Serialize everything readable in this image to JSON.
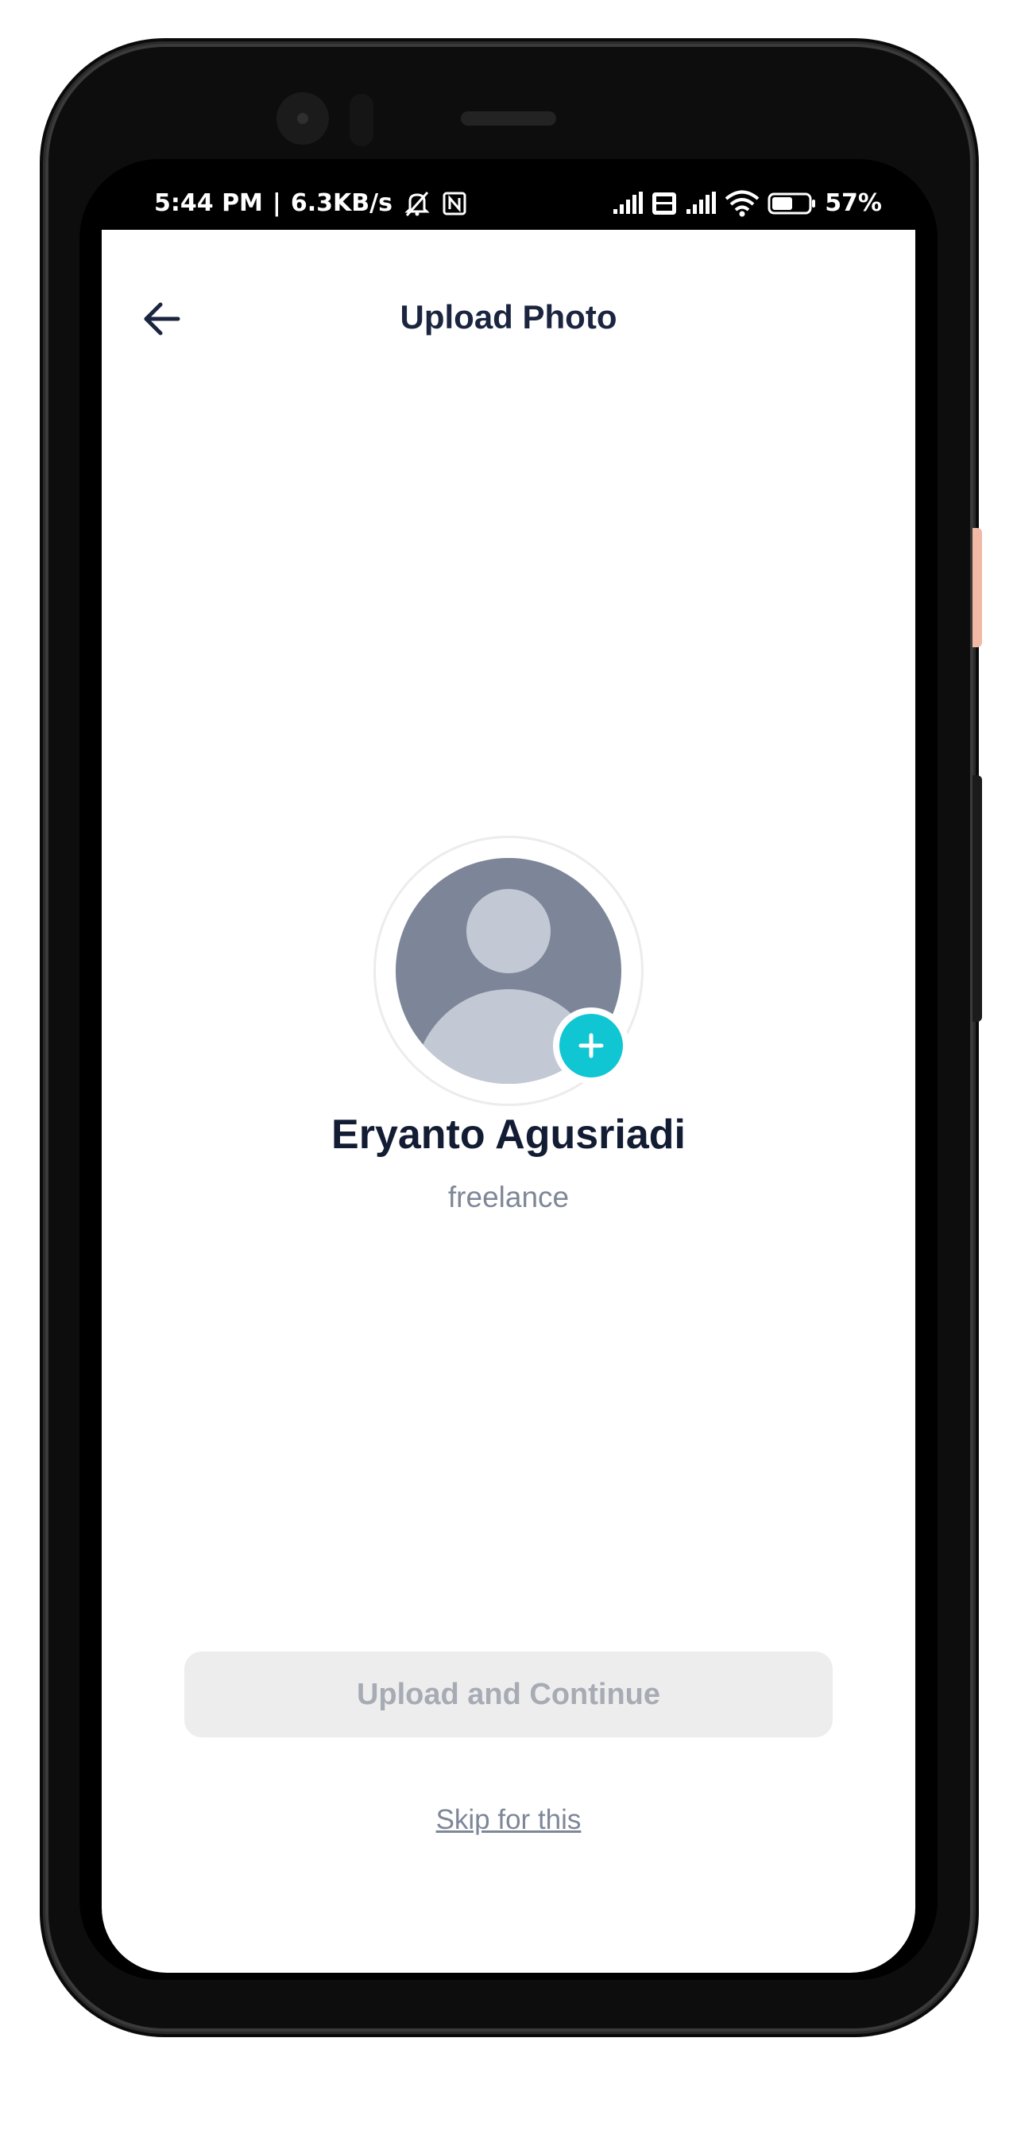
{
  "status_bar": {
    "time": "5:44 PM",
    "separator": "|",
    "network_speed": "6.3KB/s",
    "battery_percent": "57%",
    "battery_level": 0.57,
    "icons": [
      "mute-icon",
      "nfc-icon",
      "signal-icon",
      "volte-icon",
      "signal-icon",
      "wifi-icon",
      "battery-icon"
    ]
  },
  "header": {
    "title": "Upload Photo",
    "back_icon": "arrow-left-icon"
  },
  "profile": {
    "name": "Eryanto Agusriadi",
    "role": "freelance",
    "avatar_icon": "user-placeholder-icon",
    "add_icon": "plus-icon"
  },
  "actions": {
    "primary_label": "Upload and Continue",
    "primary_enabled": false,
    "skip_label": "Skip for this"
  },
  "colors": {
    "accent": "#10c6d2",
    "title_text": "#1b2540",
    "muted_text": "#7e8798",
    "disabled_button_bg": "#ededee",
    "disabled_button_text": "#a6abb4",
    "avatar_bg": "#7c8698",
    "avatar_figure": "#c3c9d4"
  }
}
